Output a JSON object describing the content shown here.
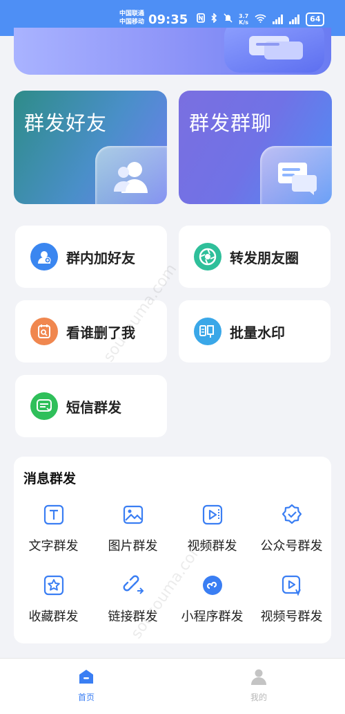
{
  "status_bar": {
    "carrier_1": "中国联通",
    "carrier_2": "中国移动",
    "time": "09:35",
    "net_speed_value": "3.7",
    "net_speed_unit": "K/s",
    "battery": "64"
  },
  "big_cards": [
    {
      "label": "群发好友",
      "icon": "contacts-icon"
    },
    {
      "label": "群发群聊",
      "icon": "chat-bubbles-icon"
    }
  ],
  "features": [
    {
      "label": "群内加好友",
      "icon": "add-user-icon",
      "color": "#3a86f0"
    },
    {
      "label": "转发朋友圈",
      "icon": "aperture-icon",
      "color": "#2fbf9a"
    },
    {
      "label": "看谁删了我",
      "icon": "check-contact-icon",
      "color": "#f0874f"
    },
    {
      "label": "批量水印",
      "icon": "seal-icon",
      "color": "#3aa7e8"
    },
    {
      "label": "短信群发",
      "icon": "sms-icon",
      "color": "#2fbf5a"
    }
  ],
  "message_section": {
    "title": "消息群发",
    "items": [
      {
        "label": "文字群发",
        "icon": "text-icon"
      },
      {
        "label": "图片群发",
        "icon": "image-icon"
      },
      {
        "label": "视频群发",
        "icon": "video-icon"
      },
      {
        "label": "公众号群发",
        "icon": "verified-icon"
      },
      {
        "label": "收藏群发",
        "icon": "star-icon"
      },
      {
        "label": "链接群发",
        "icon": "link-icon"
      },
      {
        "label": "小程序群发",
        "icon": "mini-program-icon"
      },
      {
        "label": "视频号群发",
        "icon": "channels-icon"
      }
    ]
  },
  "bottom_nav": {
    "home": "首页",
    "me": "我的"
  },
  "watermark": "sousouma.com",
  "colors": {
    "accent": "#4e8ff5",
    "active_nav": "#3a7ef3",
    "inactive_nav": "#b7b7b7"
  }
}
